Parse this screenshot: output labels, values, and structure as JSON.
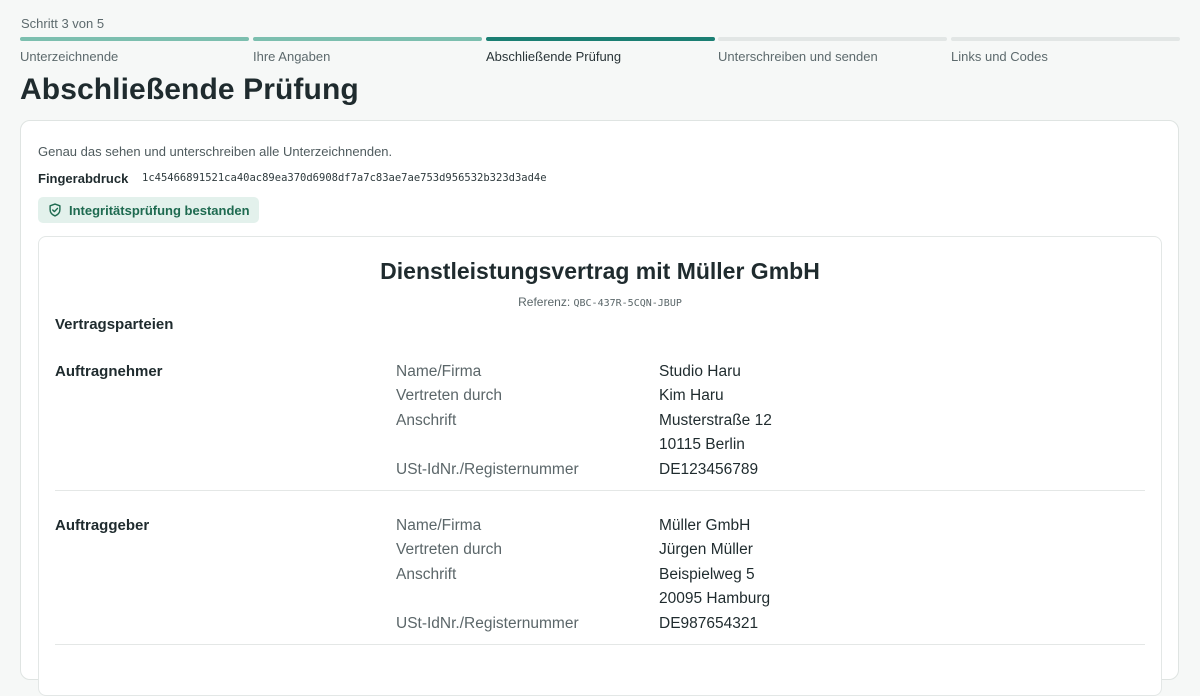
{
  "stepper": {
    "counter": "Schritt 3 von 5",
    "steps": [
      {
        "label": "Unterzeichnende",
        "state": "done"
      },
      {
        "label": "Ihre Angaben",
        "state": "done"
      },
      {
        "label": "Abschließende Prüfung",
        "state": "active"
      },
      {
        "label": "Unterschreiben und senden",
        "state": "upcoming"
      },
      {
        "label": "Links und Codes",
        "state": "upcoming"
      }
    ]
  },
  "page": {
    "title": "Abschließende Prüfung"
  },
  "review": {
    "intro": "Genau das sehen und unterschreiben alle Unterzeichnenden.",
    "fingerprint_label": "Fingerabdruck",
    "fingerprint_value": "1c45466891521ca40ac89ea370d6908df7a7c83ae7ae753d956532b323d3ad4e",
    "integrity_badge": "Integritätsprüfung bestanden",
    "badge_icon": "shield-check-icon"
  },
  "document": {
    "title": "Dienstleistungsvertrag mit Müller GmbH",
    "reference_label": "Referenz:",
    "reference_code": "QBC-437R-5CQN-JBUP",
    "section_heading": "Vertragsparteien",
    "parties": [
      {
        "title": "Auftragnehmer",
        "rows": [
          {
            "key": "Name/Firma",
            "value": "Studio Haru"
          },
          {
            "key": "Vertreten durch",
            "value": "Kim Haru"
          },
          {
            "key": "Anschrift",
            "value": "Musterstraße 12"
          },
          {
            "key": "",
            "value": "10115 Berlin"
          },
          {
            "key": "USt-IdNr./Registernummer",
            "value": "DE123456789"
          }
        ]
      },
      {
        "title": "Auftraggeber",
        "rows": [
          {
            "key": "Name/Firma",
            "value": "Müller GmbH"
          },
          {
            "key": "Vertreten durch",
            "value": "Jürgen Müller"
          },
          {
            "key": "Anschrift",
            "value": "Beispielweg 5"
          },
          {
            "key": "",
            "value": "20095 Hamburg"
          },
          {
            "key": "USt-IdNr./Registernummer",
            "value": "DE987654321"
          }
        ]
      }
    ]
  },
  "colors": {
    "background": "#f6f8f7",
    "accent": "#1b7f73",
    "step_done": "#7cbfaf",
    "step_upcoming": "#e2e6e5",
    "badge_bg": "#e3f1ec",
    "badge_text": "#1e6a50"
  }
}
